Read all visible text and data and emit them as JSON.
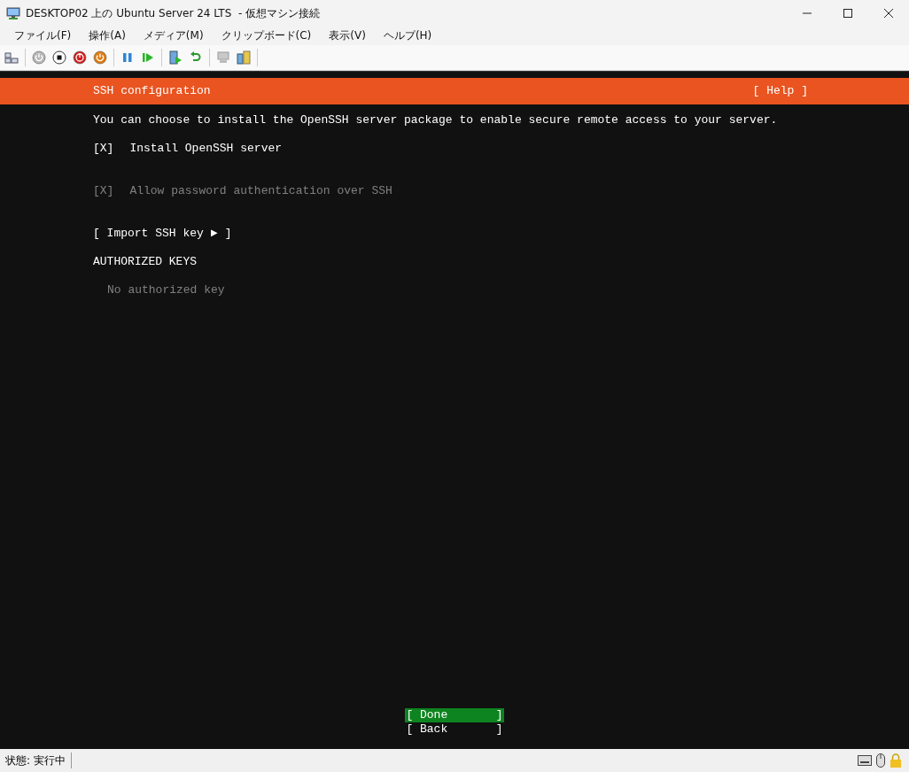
{
  "window": {
    "title": "DESKTOP02 上の Ubuntu Server 24 LTS  - 仮想マシン接続"
  },
  "menu": [
    "ファイル(F)",
    "操作(A)",
    "メディア(M)",
    "クリップボード(C)",
    "表示(V)",
    "ヘルプ(H)"
  ],
  "screen": {
    "header": {
      "title": "SSH configuration",
      "help": "[ Help ]"
    },
    "description": "You can choose to install the OpenSSH server package to enable secure remote access to your server.",
    "options": [
      {
        "box": "[X]",
        "label": "Install OpenSSH server",
        "disabled": false
      },
      {
        "box": "[X]",
        "label": "Allow password authentication over SSH",
        "disabled": true
      }
    ],
    "import_button": {
      "label": "[ Import SSH key",
      "arrow": "►",
      "close": "]"
    },
    "keys_heading": "AUTHORIZED KEYS",
    "keys_empty": "No authorized key",
    "buttons": [
      {
        "label": "[ Done       ]",
        "selected": true
      },
      {
        "label": "[ Back       ]",
        "selected": false
      }
    ]
  },
  "status_bar": {
    "text": "状態: 実行中"
  }
}
